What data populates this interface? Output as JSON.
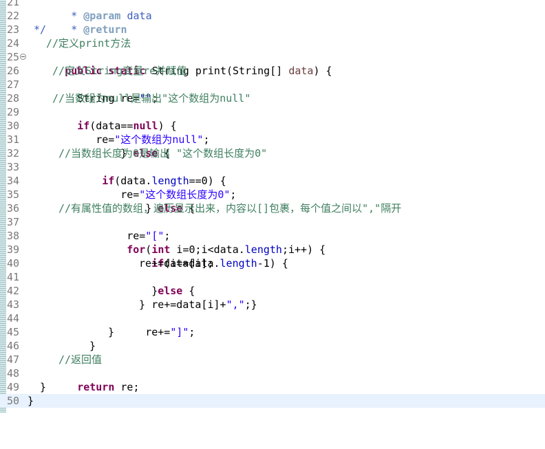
{
  "editor": {
    "line_numbers": [
      "21",
      "22",
      "23",
      "24",
      "25",
      "26",
      "27",
      "28",
      "29",
      "30",
      "31",
      "32",
      "33",
      "34",
      "35",
      "36",
      "37",
      "38",
      "39",
      "40",
      "41",
      "42",
      "43",
      "44",
      "45",
      "46",
      "47",
      "48",
      "49",
      "50"
    ],
    "code": {
      "l21_star": " * ",
      "l21_tag": "@param",
      "l21_rest": " data",
      "l22_star": " * ",
      "l22_tag": "@return",
      "l23_end": " */",
      "l24_comment": "//定义print方法",
      "l25_public": "public",
      "l25_static": "static",
      "l25_a": " String print(String[] ",
      "l25_param": "data",
      "l25_b": ") {",
      "l26_comment": "//定义String变量re并赋值",
      "l27_a": "String re=",
      "l27_str": "\"\"",
      "l27_b": ";",
      "l28_comment": "//当数组为null是输出\"这个数组为null\"",
      "l29_if": "if",
      "l29_a": "(data==",
      "l29_null": "null",
      "l29_b": ") {",
      "l30_a": "re=",
      "l30_str": "\"这个数组为null\"",
      "l30_b": ";",
      "l31_a": "} ",
      "l31_else": "else",
      "l31_b": " {",
      "l32_comment": "//当数组长度为0是输出 \"这个数组长度为0\"",
      "l33_if": "if",
      "l33_a": "(data.",
      "l33_length": "length",
      "l33_b": "==0) {",
      "l34_a": "re=",
      "l34_str": "\"这个数组长度为0\"",
      "l34_b": ";",
      "l35_a": "} ",
      "l35_else": "else",
      "l35_b": " {",
      "l36_comment": "//有属性值的数组，遍历显示出来，内容以[]包裹，每个值之间以\",\"隔开",
      "l37_a": "re=",
      "l37_str": "\"[\"",
      "l37_b": ";",
      "l38_for": "for",
      "l38_a": "(",
      "l38_int": "int",
      "l38_b": " i=0;i<data.",
      "l38_length": "length",
      "l38_c": ";i++) {",
      "l39_if": "if",
      "l39_a": "(i==data.",
      "l39_length": "length",
      "l39_b": "-1) {",
      "l40": "re+=data[i];",
      "l41_a": "}",
      "l41_else": "else",
      "l41_b": " {",
      "l42_a": "re+=data[i]+",
      "l42_str": "\",\"",
      "l42_b": ";}",
      "l43": "}",
      "l44_a": "re+=",
      "l44_str": "\"]\"",
      "l44_b": ";",
      "l45": "}",
      "l46": "}",
      "l47_comment": "//返回值",
      "l48_return": "return",
      "l48_b": " re;",
      "l49": "}",
      "l50": "}"
    }
  }
}
